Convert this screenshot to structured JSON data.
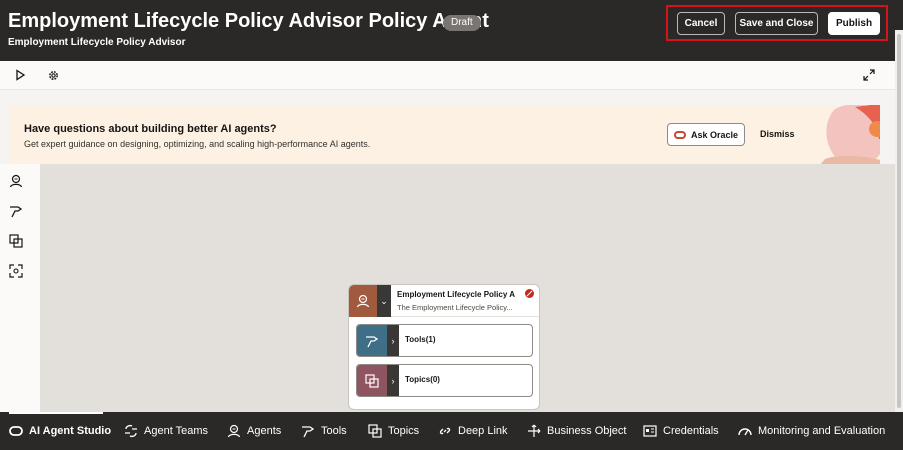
{
  "header": {
    "title": "Employment Lifecycle Policy Advisor Policy Agent",
    "badge": "Draft",
    "subtitle": "Employment Lifecycle Policy Advisor",
    "cancel_label": "Cancel",
    "save_close_label": "Save and Close",
    "publish_label": "Publish"
  },
  "toolbar": {
    "icons": [
      "play-icon",
      "gear-icon",
      "expand-icon"
    ]
  },
  "banner": {
    "title": "Have questions about building better AI agents?",
    "text": "Get expert guidance on designing, optimizing, and scaling high-performance AI agents.",
    "ask_label": "Ask Oracle",
    "dismiss_label": "Dismiss"
  },
  "left_rail": {
    "icons": [
      "agent-icon",
      "tools-icon",
      "topics-icon",
      "deep-link-icon"
    ]
  },
  "node": {
    "title": "Employment Lifecycle Policy Ad",
    "description": "The Employment Lifecycle Policy...",
    "tools_label": "Tools(1)",
    "topics_label": "Topics(0)"
  },
  "bottom_nav": {
    "items": [
      {
        "label": "AI Agent Studio",
        "icon": "oracle-icon",
        "active": true
      },
      {
        "label": "Agent Teams",
        "icon": "agent-teams-icon"
      },
      {
        "label": "Agents",
        "icon": "agent-icon"
      },
      {
        "label": "Tools",
        "icon": "tools-icon"
      },
      {
        "label": "Topics",
        "icon": "topics-icon"
      },
      {
        "label": "Deep Link",
        "icon": "link-icon"
      },
      {
        "label": "Business Object",
        "icon": "business-object-icon"
      },
      {
        "label": "Credentials",
        "icon": "credentials-icon"
      },
      {
        "label": "Monitoring and Evaluation",
        "icon": "monitoring-icon"
      }
    ]
  },
  "colors": {
    "header_bg": "#2b2927",
    "banner_bg": "#fcf1e2",
    "canvas_bg": "#e3e0dc",
    "agent_accent": "#a15a3e",
    "tools_accent": "#3f6f87",
    "topics_accent": "#8e5460",
    "highlight": "#d6121a"
  }
}
